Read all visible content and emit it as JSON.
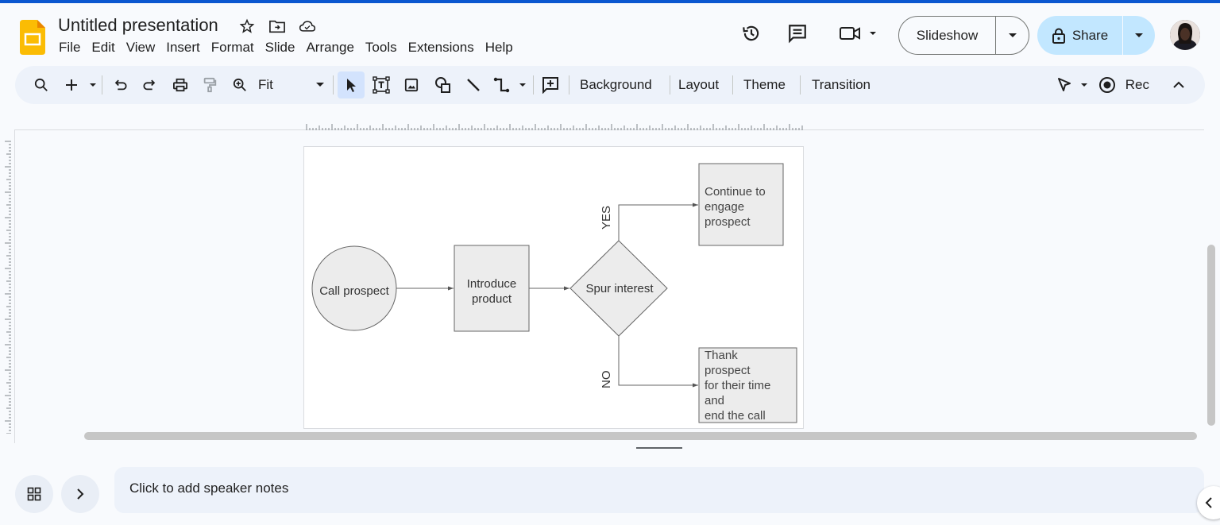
{
  "header": {
    "title": "Untitled presentation",
    "menu": [
      "File",
      "Edit",
      "View",
      "Insert",
      "Format",
      "Slide",
      "Arrange",
      "Tools",
      "Extensions",
      "Help"
    ],
    "slideshow_label": "Slideshow",
    "share_label": "Share"
  },
  "toolbar": {
    "zoom_label": "Fit",
    "background_label": "Background",
    "layout_label": "Layout",
    "theme_label": "Theme",
    "transition_label": "Transition",
    "rec_label": "Rec"
  },
  "slide": {
    "start_node": "Call prospect",
    "step_node_line1": "Introduce",
    "step_node_line2": "product",
    "decision_node": "Spur interest",
    "yes_label": "YES",
    "no_label": "NO",
    "yes_node_line1": "Continue to",
    "yes_node_line2": "engage",
    "yes_node_line3": "prospect",
    "no_node_line1": "Thank",
    "no_node_line2": "prospect",
    "no_node_line3": "for their time",
    "no_node_line4": "and",
    "no_node_line5": "end the call"
  },
  "notes": {
    "placeholder": "Click to add speaker notes"
  },
  "colors": {
    "accent": "#0b57d0",
    "share_bg": "#c2e7ff",
    "toolbar_bg": "#edf2fa",
    "node_fill": "#ececec",
    "node_stroke": "#666666"
  }
}
